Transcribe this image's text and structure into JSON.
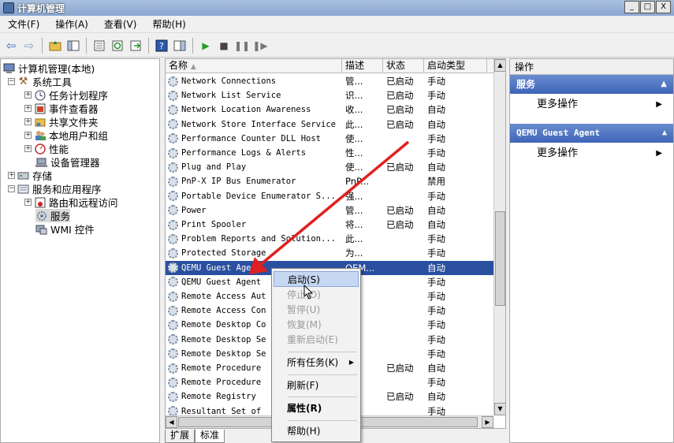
{
  "window": {
    "title": "计算机管理",
    "btn_min": "_",
    "btn_max": "□",
    "btn_close": "X"
  },
  "menu": [
    "文件(F)",
    "操作(A)",
    "查看(V)",
    "帮助(H)"
  ],
  "tree": {
    "root": "计算机管理(本地)",
    "system_tools": "系统工具",
    "task_scheduler": "任务计划程序",
    "event_viewer": "事件查看器",
    "shared_folders": "共享文件夹",
    "local_users": "本地用户和组",
    "performance": "性能",
    "device_manager": "设备管理器",
    "storage": "存储",
    "services_apps": "服务和应用程序",
    "routing": "路由和远程访问",
    "services": "服务",
    "wmi": "WMI 控件"
  },
  "list": {
    "headers": {
      "name": "名称",
      "desc": "描述",
      "status": "状态",
      "startup": "启动类型"
    },
    "rows": [
      {
        "name": "Network Connections",
        "desc": "管...",
        "status": "已启动",
        "startup": "手动"
      },
      {
        "name": "Network List Service",
        "desc": "识...",
        "status": "已启动",
        "startup": "手动"
      },
      {
        "name": "Network Location Awareness",
        "desc": "收...",
        "status": "已启动",
        "startup": "自动"
      },
      {
        "name": "Network Store Interface Service",
        "desc": "此...",
        "status": "已启动",
        "startup": "自动"
      },
      {
        "name": "Performance Counter DLL Host",
        "desc": "使...",
        "status": "",
        "startup": "手动"
      },
      {
        "name": "Performance Logs & Alerts",
        "desc": "性...",
        "status": "",
        "startup": "手动"
      },
      {
        "name": "Plug and Play",
        "desc": "使...",
        "status": "已启动",
        "startup": "自动"
      },
      {
        "name": "PnP-X IP Bus Enumerator",
        "desc": "PnP...",
        "status": "",
        "startup": "禁用"
      },
      {
        "name": "Portable Device Enumerator S...",
        "desc": "强...",
        "status": "",
        "startup": "手动"
      },
      {
        "name": "Power",
        "desc": "管...",
        "status": "已启动",
        "startup": "自动"
      },
      {
        "name": "Print Spooler",
        "desc": "将...",
        "status": "已启动",
        "startup": "自动"
      },
      {
        "name": "Problem Reports and Solution...",
        "desc": "此...",
        "status": "",
        "startup": "手动"
      },
      {
        "name": "Protected Storage",
        "desc": "为...",
        "status": "",
        "startup": "手动"
      },
      {
        "name": "QEMU Guest Agent",
        "desc": "QEM...",
        "status": "",
        "startup": "自动"
      },
      {
        "name": "QEMU Guest Agent",
        "desc": "",
        "status": "",
        "startup": "手动"
      },
      {
        "name": "Remote Access Aut",
        "desc": "",
        "status": "",
        "startup": "手动"
      },
      {
        "name": "Remote Access Con",
        "desc": "",
        "status": "",
        "startup": "手动"
      },
      {
        "name": "Remote Desktop Co",
        "desc": "",
        "status": "",
        "startup": "手动"
      },
      {
        "name": "Remote Desktop Se",
        "desc": "",
        "status": "",
        "startup": "手动"
      },
      {
        "name": "Remote Desktop Se",
        "desc": "",
        "status": "",
        "startup": "手动"
      },
      {
        "name": "Remote Procedure",
        "desc": "",
        "status": "已启动",
        "startup": "自动"
      },
      {
        "name": "Remote Procedure",
        "desc": "",
        "status": "",
        "startup": "手动"
      },
      {
        "name": "Remote Registry",
        "desc": "",
        "status": "已启动",
        "startup": "自动"
      },
      {
        "name": "Resultant Set of",
        "desc": "",
        "status": "",
        "startup": "手动"
      }
    ]
  },
  "tabs": {
    "extended": "扩展",
    "standard": "标准"
  },
  "actions": {
    "header": "操作",
    "section1": "服务",
    "more1": "更多操作",
    "section2": "QEMU Guest Agent",
    "more2": "更多操作"
  },
  "context_menu": {
    "start": "启动(S)",
    "stop": "停止(O)",
    "pause": "暂停(U)",
    "resume": "恢复(M)",
    "restart": "重新启动(E)",
    "all_tasks": "所有任务(K)",
    "refresh": "刷新(F)",
    "properties": "属性(R)",
    "help": "帮助(H)"
  },
  "colors": {
    "selection": "#2a4fa0",
    "annotation_arrow": "#e02020",
    "action_header": "#3e64b8"
  }
}
